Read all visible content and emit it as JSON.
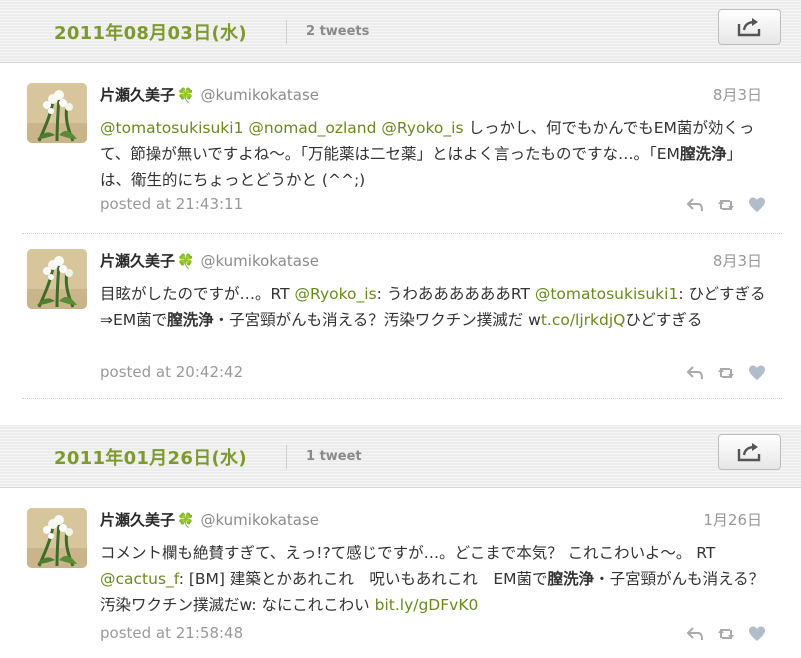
{
  "sections": [
    {
      "date": "2011年08月03日(水)",
      "tweet_count": "2 tweets",
      "tweets": [
        {
          "user_name": "片瀬久美子",
          "clover": "🍀",
          "handle": "@kumikokatase",
          "date": "8月3日",
          "body": [
            {
              "t": "link",
              "v": "@tomatosukisuki1"
            },
            {
              "t": "text",
              "v": " "
            },
            {
              "t": "link",
              "v": "@nomad_ozland"
            },
            {
              "t": "text",
              "v": " "
            },
            {
              "t": "link",
              "v": "@Ryoko_is"
            },
            {
              "t": "text",
              "v": " しっかし、何でもかんでもEM菌が効くって、節操が無いですよね〜。「万能薬は二セ薬」とはよく言ったものですな…。「EM"
            },
            {
              "t": "bold",
              "v": "膣洗浄"
            },
            {
              "t": "text",
              "v": "」は、衛生的にちょっとどうかと (^^;)"
            }
          ],
          "posted": "posted at 21:43:11"
        },
        {
          "user_name": "片瀬久美子",
          "clover": "🍀",
          "handle": "@kumikokatase",
          "date": "8月3日",
          "body": [
            {
              "t": "text",
              "v": "目眩がしたのですが…。RT "
            },
            {
              "t": "link",
              "v": "@Ryoko_is"
            },
            {
              "t": "text",
              "v": ": うわああああああRT "
            },
            {
              "t": "link",
              "v": "@tomatosukisuki1"
            },
            {
              "t": "text",
              "v": ": ひどすぎる⇒EM菌で"
            },
            {
              "t": "bold",
              "v": "膣洗浄"
            },
            {
              "t": "text",
              "v": "・子宮頸がんも消える？汚染ワクチン撲滅だ w"
            },
            {
              "t": "link",
              "v": "t.co/ljrkdjQ"
            },
            {
              "t": "text",
              "v": "ひどすぎる"
            }
          ],
          "posted": "posted at 20:42:42"
        }
      ]
    },
    {
      "date": "2011年01月26日(水)",
      "tweet_count": "1 tweet",
      "tweets": [
        {
          "user_name": "片瀬久美子",
          "clover": "🍀",
          "handle": "@kumikokatase",
          "date": "1月26日",
          "body": [
            {
              "t": "text",
              "v": "コメント欄も絶賛すぎて、えっ!?て感じですが…。どこまで本気？ これこわいよ〜。 RT "
            },
            {
              "t": "link",
              "v": "@cactus_f"
            },
            {
              "t": "text",
              "v": ": [BM] 建築とかあれこれ　呪いもあれこれ　EM菌で"
            },
            {
              "t": "bold",
              "v": "膣洗浄"
            },
            {
              "t": "text",
              "v": "・子宮頸がんも消える？汚染ワクチン撲滅だw: なにこれこわい "
            },
            {
              "t": "link",
              "v": "bit.ly/gDFvK0"
            }
          ],
          "posted": "posted at 21:58:48"
        }
      ]
    }
  ],
  "icons": {
    "share": "share-icon",
    "reply": "reply-icon",
    "retweet": "retweet-icon",
    "favorite": "heart-icon"
  },
  "colors": {
    "date_green": "#7e9a2f",
    "link_green": "#6a8a1f",
    "clover_green": "#4aa23c"
  }
}
